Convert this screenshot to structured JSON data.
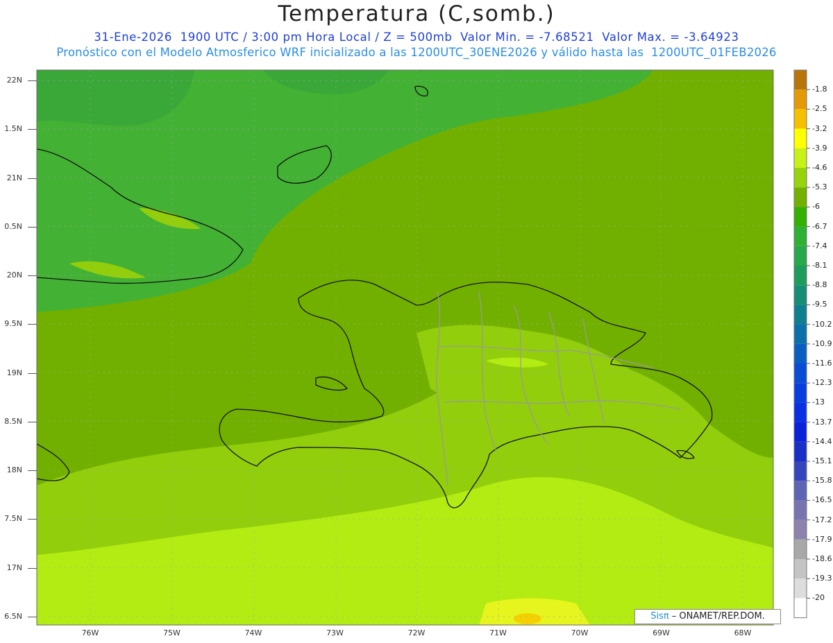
{
  "title": "Temperatura (C,somb.)",
  "subtitle_line1": "31-Ene-2026  1900 UTC / 3:00 pm Hora Local / Z = 500mb  Valor Min. = -7.68521  Valor Max. = -3.64923",
  "subtitle_line2": "Pronóstico con el Modelo Atmosferico WRF inicializado a las 1200UTC_30ENE2026 y válido hasta las  1200UTC_01FEB2026",
  "valid_time": "31-Ene-2026 1900 UTC",
  "local_time": "3:00 pm Hora Local",
  "level": "Z = 500mb",
  "value_min": -7.68521,
  "value_max": -3.64923,
  "lat_labels": [
    "22N",
    "1.5N",
    "21N",
    "0.5N",
    "20N",
    "9.5N",
    "19N",
    "8.5N",
    "18N",
    "7.5N",
    "17N",
    "6.5N"
  ],
  "lon_labels": [
    "76W",
    "75W",
    "74W",
    "73W",
    "72W",
    "71W",
    "70W",
    "69W",
    "68W"
  ],
  "colorbar": {
    "labels": [
      "-1.8",
      "-2.5",
      "-3.2",
      "-3.9",
      "-4.6",
      "-5.3",
      "-6",
      "-6.7",
      "-7.4",
      "-8.1",
      "-8.8",
      "-9.5",
      "-10.2",
      "-10.9",
      "-11.6",
      "-12.3",
      "-13",
      "-13.7",
      "-14.4",
      "-15.1",
      "-15.8",
      "-16.5",
      "-17.2",
      "-17.9",
      "-18.6",
      "-19.3",
      "-20"
    ],
    "colors": [
      "#b8760a",
      "#e39a06",
      "#f5c000",
      "#ffff00",
      "#c6f218",
      "#97d40e",
      "#73b000",
      "#33b000",
      "#2eb035",
      "#27a84a",
      "#1f9b5c",
      "#168d75",
      "#0d7f8e",
      "#0b6fa8",
      "#0a5ec2",
      "#0a4cd6",
      "#0a3de0",
      "#0a2fe4",
      "#0a22d8",
      "#1a2ec8",
      "#3546bd",
      "#5c64b6",
      "#7874b2",
      "#8d83ae",
      "#a8a8a8",
      "#c4c4c4",
      "#dddddd",
      "#ffffff"
    ]
  },
  "field_colors": {
    "c_m7": "#3aa838",
    "c_m67": "#43b133",
    "c_m6": "#72b000",
    "c_m53": "#92ce0b",
    "c_m46": "#b3ec13",
    "c_m39": "#e6f51d",
    "c_m32": "#f5d000"
  },
  "credit": {
    "sis": "Sisπ",
    "text": " – ONAMET/REP.DOM."
  }
}
